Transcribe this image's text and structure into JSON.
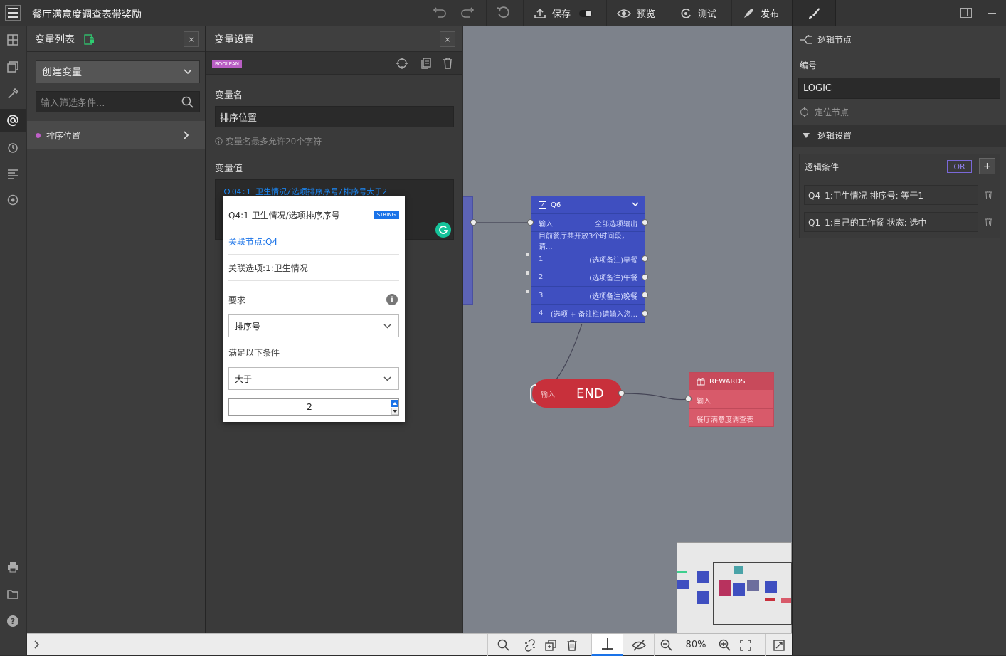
{
  "app": {
    "title": "餐厅满意度调查表带奖励"
  },
  "toolbar": {
    "save": "保存",
    "preview": "预览",
    "test": "测试",
    "publish": "发布"
  },
  "var_list": {
    "title": "变量列表",
    "close": "×",
    "create_label": "创建变量",
    "filter_placeholder": "输入筛选条件...",
    "items": [
      {
        "label": "排序位置",
        "dot_color": "#c060c8"
      }
    ]
  },
  "var_settings": {
    "title": "变量设置",
    "close": "×",
    "type_badge": "BOOLEAN",
    "name_label": "变量名",
    "name_value": "排序位置",
    "name_hint": "变量名最多允许20个字符",
    "value_label": "变量值",
    "value_expr": "Q4:1 卫生情况/选项排序序号/排序号大于2"
  },
  "popup": {
    "title": "Q4:1 卫生情况/选项排序序号",
    "badge": "STRING",
    "node_link": "关联节点:Q4",
    "option_link": "关联选项:1:卫生情况",
    "require_label": "要求",
    "require_value": "排序号",
    "condition_label": "满足以下条件",
    "condition_value": "大于",
    "number_value": "2"
  },
  "canvas": {
    "q6": {
      "title": "Q6",
      "input": "输入",
      "all_output": "全部选项输出",
      "desc": "目前餐厅共开放3个时间段，请...",
      "options": [
        {
          "num": "1",
          "text": "(选项备注)早餐"
        },
        {
          "num": "2",
          "text": "(选项备注)午餐"
        },
        {
          "num": "3",
          "text": "(选项备注)晚餐"
        },
        {
          "num": "4",
          "text": "(选项 + 备注栏)请输入您..."
        }
      ]
    },
    "end": {
      "input": "输入",
      "label": "END"
    },
    "rewards": {
      "title": "REWARDS",
      "input": "输入",
      "desc": "餐厅满意度调查表"
    }
  },
  "right_panel": {
    "node_type": "逻辑节点",
    "id_label": "编号",
    "id_value": "LOGIC",
    "locate": "定位节点",
    "section": "逻辑设置",
    "conditions_label": "逻辑条件",
    "or_label": "OR",
    "add": "+",
    "conditions": [
      "Q4–1:卫生情况 排序号: 等于1",
      "Q1–1:自己的工作餐 状态: 选中"
    ]
  },
  "bottom": {
    "zoom": "80%"
  },
  "colors": {
    "node_blue": "#3f4fc0",
    "end_red": "#c8303b",
    "rewards_red": "#d85a6a",
    "accent_blue": "#1a73e8",
    "badge_purple": "#b95fc4"
  }
}
